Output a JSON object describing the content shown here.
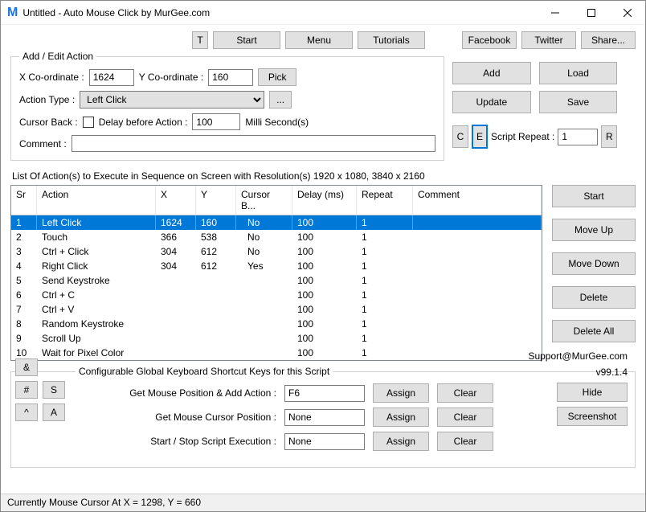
{
  "window": {
    "title": "Untitled - Auto Mouse Click by MurGee.com"
  },
  "topbar": {
    "t": "T",
    "start": "Start",
    "menu": "Menu",
    "tutorials": "Tutorials",
    "facebook": "Facebook",
    "twitter": "Twitter",
    "share": "Share..."
  },
  "edit": {
    "legend": "Add / Edit Action",
    "x_label": "X Co-ordinate :",
    "x_value": "1624",
    "y_label": "Y Co-ordinate :",
    "y_value": "160",
    "pick": "Pick",
    "action_type_label": "Action Type :",
    "action_type": "Left Click",
    "more": "...",
    "cursor_back_label": "Cursor Back :",
    "delay_label": "Delay before Action :",
    "delay_value": "100",
    "delay_unit": "Milli Second(s)",
    "comment_label": "Comment :",
    "comment_value": "",
    "c_btn": "C",
    "e_btn": "E",
    "repeat_label": "Script Repeat :",
    "repeat_value": "1",
    "r_btn": "R",
    "add": "Add",
    "load": "Load",
    "update": "Update",
    "save": "Save"
  },
  "list": {
    "title": "List Of Action(s) to Execute in Sequence on Screen with Resolution(s) 1920 x 1080, 3840 x 2160",
    "headers": {
      "sr": "Sr",
      "action": "Action",
      "x": "X",
      "y": "Y",
      "cursor": "Cursor B...",
      "delay": "Delay (ms)",
      "repeat": "Repeat",
      "comment": "Comment"
    },
    "rows": [
      {
        "sr": "1",
        "action": "Left Click",
        "x": "1624",
        "y": "160",
        "cursor": "No",
        "delay": "100",
        "repeat": "1",
        "comment": ""
      },
      {
        "sr": "2",
        "action": "Touch",
        "x": "366",
        "y": "538",
        "cursor": "No",
        "delay": "100",
        "repeat": "1",
        "comment": ""
      },
      {
        "sr": "3",
        "action": "Ctrl + Click",
        "x": "304",
        "y": "612",
        "cursor": "No",
        "delay": "100",
        "repeat": "1",
        "comment": ""
      },
      {
        "sr": "4",
        "action": "Right Click",
        "x": "304",
        "y": "612",
        "cursor": "Yes",
        "delay": "100",
        "repeat": "1",
        "comment": ""
      },
      {
        "sr": "5",
        "action": "Send Keystroke",
        "x": "",
        "y": "",
        "cursor": "",
        "delay": "100",
        "repeat": "1",
        "comment": ""
      },
      {
        "sr": "6",
        "action": "Ctrl + C",
        "x": "",
        "y": "",
        "cursor": "",
        "delay": "100",
        "repeat": "1",
        "comment": ""
      },
      {
        "sr": "7",
        "action": "Ctrl + V",
        "x": "",
        "y": "",
        "cursor": "",
        "delay": "100",
        "repeat": "1",
        "comment": ""
      },
      {
        "sr": "8",
        "action": "Random Keystroke",
        "x": "",
        "y": "",
        "cursor": "",
        "delay": "100",
        "repeat": "1",
        "comment": ""
      },
      {
        "sr": "9",
        "action": "Scroll Up",
        "x": "",
        "y": "",
        "cursor": "",
        "delay": "100",
        "repeat": "1",
        "comment": ""
      },
      {
        "sr": "10",
        "action": "Wait for Pixel Color",
        "x": "",
        "y": "",
        "cursor": "",
        "delay": "100",
        "repeat": "1",
        "comment": ""
      }
    ],
    "side": {
      "start": "Start",
      "moveup": "Move Up",
      "movedown": "Move Down",
      "delete": "Delete",
      "deleteall": "Delete All"
    }
  },
  "shortcuts": {
    "legend": "Configurable Global Keyboard Shortcut Keys for this Script",
    "rows": [
      {
        "label": "Get Mouse Position & Add Action :",
        "value": "F6"
      },
      {
        "label": "Get Mouse Cursor Position :",
        "value": "None"
      },
      {
        "label": "Start / Stop Script Execution :",
        "value": "None"
      }
    ],
    "assign": "Assign",
    "clear": "Clear"
  },
  "keys": {
    "amp": "&",
    "hash": "#",
    "s": "S",
    "caret": "^",
    "a": "A"
  },
  "info": {
    "support": "Support@MurGee.com",
    "version": "v99.1.4",
    "hide": "Hide",
    "screenshot": "Screenshot"
  },
  "status": "Currently Mouse Cursor At X = 1298, Y = 660"
}
